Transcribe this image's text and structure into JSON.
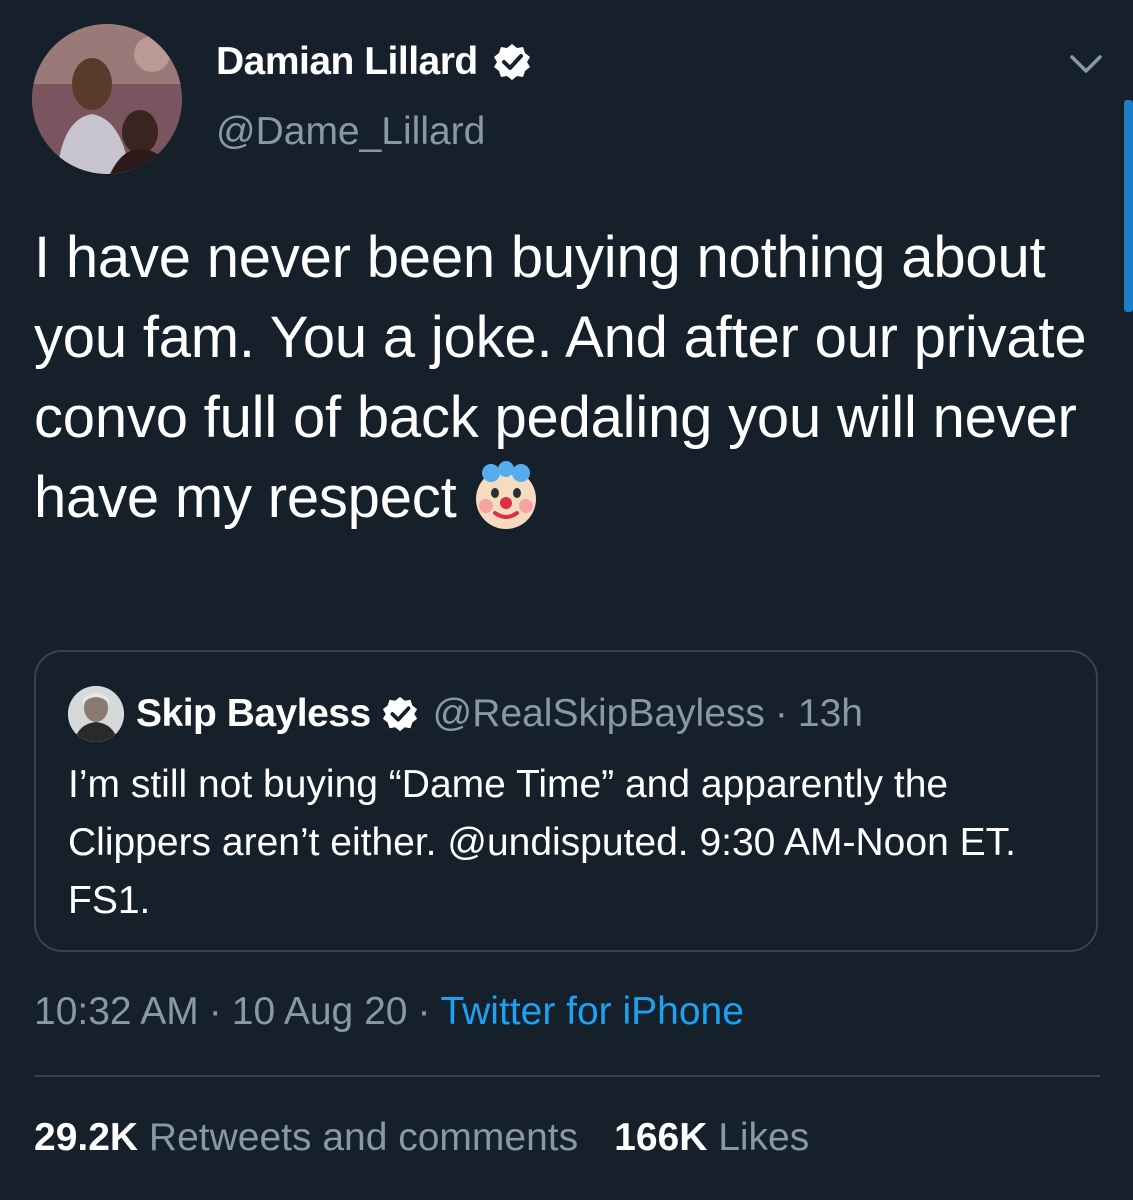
{
  "tweet": {
    "author_name": "Damian Lillard",
    "author_handle": "@Dame_Lillard",
    "text": "I have never been buying nothing about you fam. You a joke. And after our private convo full of back pedaling you will never have my respect",
    "emoji": "clown-face",
    "time": "10:32 AM",
    "date": "10 Aug 20",
    "source": "Twitter for iPhone",
    "separator": "·"
  },
  "quoted": {
    "author_name": "Skip Bayless",
    "author_handle": "@RealSkipBayless",
    "separator": "·",
    "age": "13h",
    "text": "I’m still not buying “Dame Time” and apparently the Clippers aren’t either. @undisputed. 9:30 AM-Noon ET. FS1."
  },
  "stats": {
    "retweets_count": "29.2K",
    "retweets_label": "Retweets and comments",
    "likes_count": "166K",
    "likes_label": "Likes"
  },
  "colors": {
    "background": "#15202b",
    "secondary_text": "#8899a6",
    "accent": "#1da1f2",
    "border": "#38444d"
  }
}
